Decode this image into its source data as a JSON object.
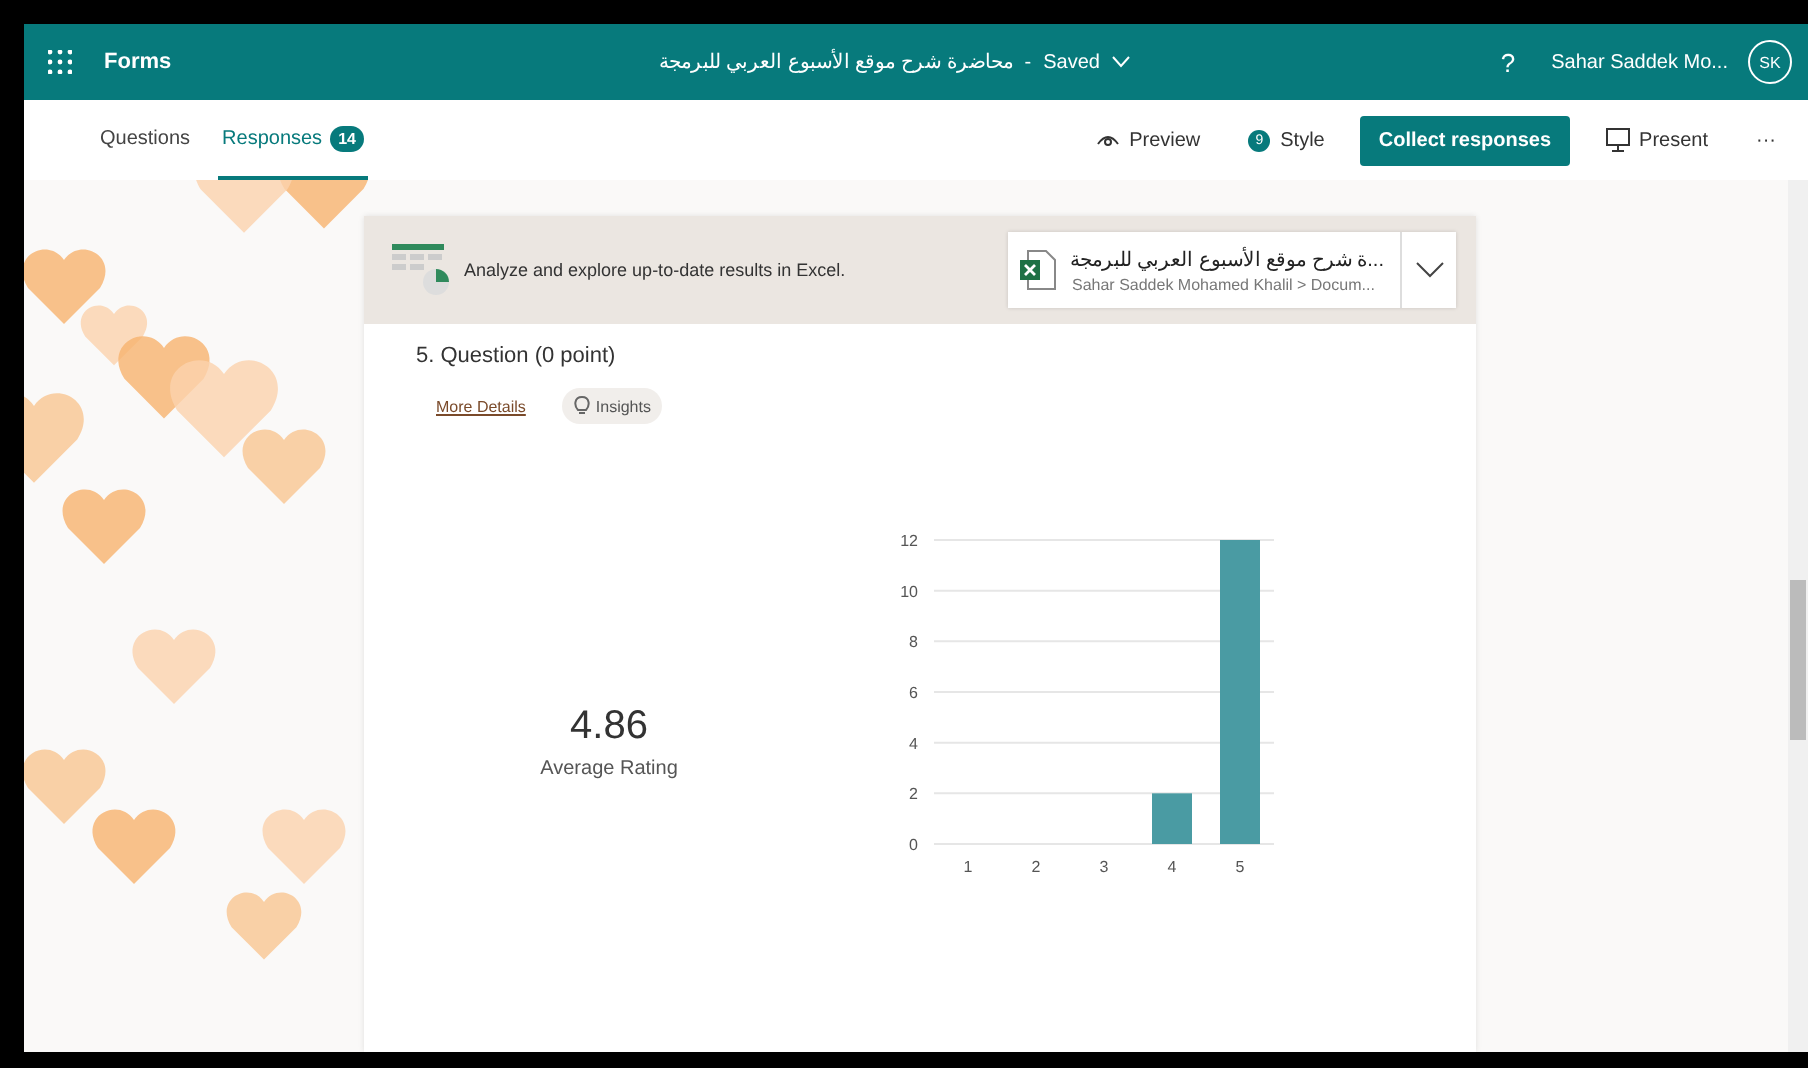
{
  "header": {
    "app_name": "Forms",
    "form_title": "محاضرة شرح موقع الأسبوع العربي للبرمجة",
    "separator": "-",
    "save_status": "Saved",
    "help": "?",
    "user_name": "Sahar Saddek Mo...",
    "avatar_initials": "SK"
  },
  "tabs": [
    {
      "label": "Questions",
      "selected": false
    },
    {
      "label": "Responses",
      "selected": true,
      "badge": "14"
    }
  ],
  "toolbar": {
    "preview": "Preview",
    "style": "Style",
    "style_badge": "9",
    "collect": "Collect responses",
    "present": "Present",
    "more": "···"
  },
  "excel_banner": {
    "text": "Analyze and explore up-to-date results in Excel.",
    "file_title": "...ة شرح موقع الأسبوع العربي للبرمجة",
    "file_path": "Sahar Saddek Mohamed Khalil > Docum..."
  },
  "question": {
    "title": "5. Question (0 point)",
    "more_details": "More Details",
    "insights": "Insights",
    "average": "4.86",
    "average_label": "Average Rating",
    "chart_data": {
      "type": "bar",
      "categories": [
        "1",
        "2",
        "3",
        "4",
        "5"
      ],
      "values": [
        0,
        0,
        0,
        2,
        12
      ],
      "ylim": [
        0,
        12
      ],
      "grid": true,
      "yticks": [
        0,
        2,
        4,
        6,
        8,
        10,
        12
      ]
    }
  }
}
